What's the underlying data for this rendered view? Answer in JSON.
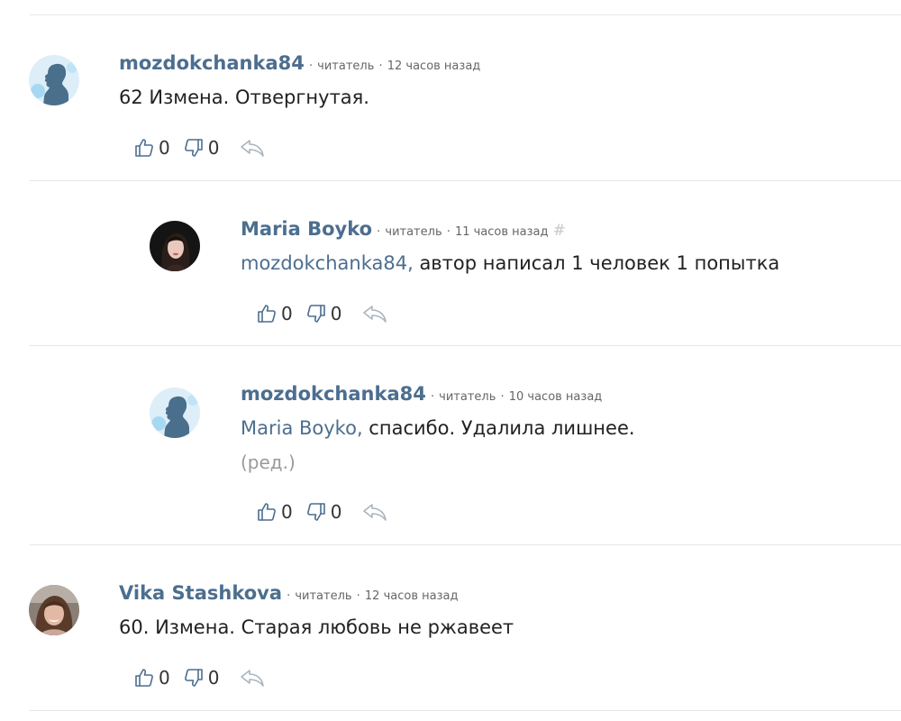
{
  "comments": [
    {
      "author": "mozdokchanka84",
      "role": "читатель",
      "time": "12 часов назад",
      "text": "62 Измена. Отвергнутая.",
      "likes": "0",
      "dislikes": "0"
    },
    {
      "author": "Maria Boyko",
      "role": "читатель",
      "time": "11 часов назад",
      "hash": "#",
      "mention": "mozdokchanka84,",
      "text": " автор написал 1 человек 1 попытка",
      "likes": "0",
      "dislikes": "0"
    },
    {
      "author": "mozdokchanka84",
      "role": "читатель",
      "time": "10 часов назад",
      "mention": "Maria Boyko,",
      "text": " спасибо. Удалила лишнее.",
      "edited": "(ред.)",
      "likes": "0",
      "dislikes": "0"
    },
    {
      "author": "Vika Stashkova",
      "role": "читатель",
      "time": "12 часов назад",
      "text": "60. Измена. Старая любовь не ржавеет",
      "likes": "0",
      "dislikes": "0"
    }
  ],
  "separator": "·",
  "icons": {
    "like": "thumbs-up-icon",
    "dislike": "thumbs-down-icon",
    "reply": "reply-icon"
  },
  "colors": {
    "author": "#4c6e8f",
    "icon": "#4c6e8f",
    "reply_icon": "#a9b4bf",
    "divider": "#e6e6e6"
  }
}
